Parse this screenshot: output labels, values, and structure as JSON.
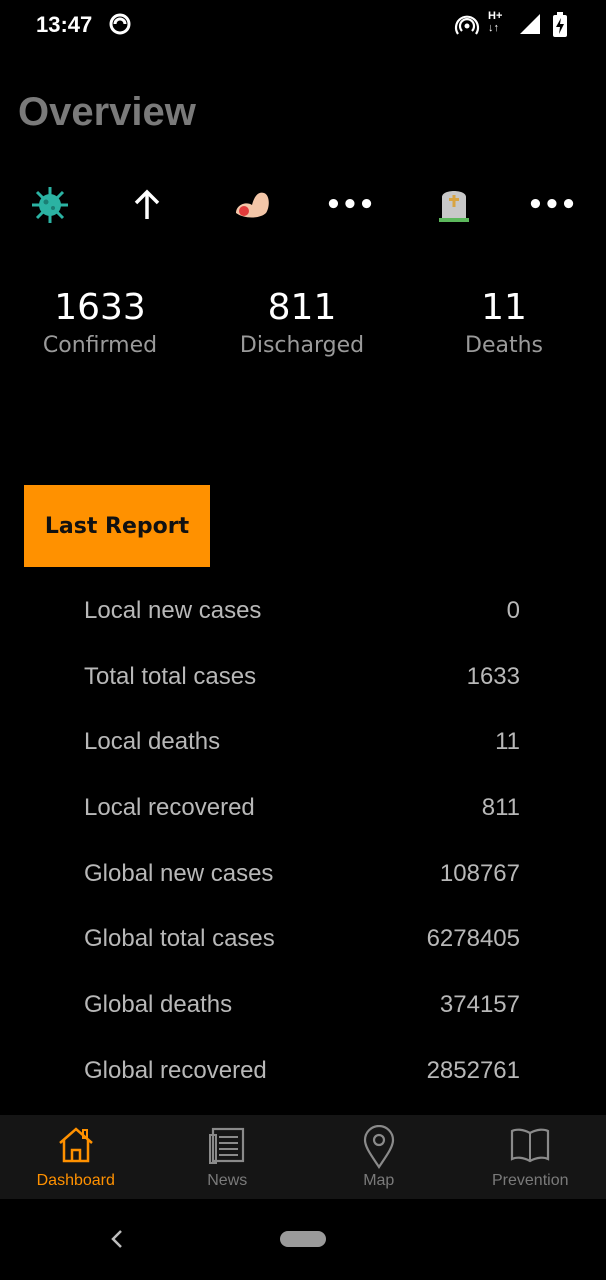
{
  "status_bar": {
    "time": "13:47",
    "network_label": "H+"
  },
  "page": {
    "title": "Overview"
  },
  "icons": [
    "virus-icon",
    "arrow-up-icon",
    "flexed-biceps-icon",
    "more-icon",
    "headstone-icon",
    "more-icon"
  ],
  "stats": {
    "confirmed": {
      "value": "1633",
      "label": "Confirmed"
    },
    "discharged": {
      "value": "811",
      "label": "Discharged"
    },
    "deaths": {
      "value": "11",
      "label": "Deaths"
    }
  },
  "last_report": {
    "button_label": "Last Report",
    "rows": [
      {
        "label": "Local new cases",
        "value": "0"
      },
      {
        "label": "Total total cases",
        "value": "1633"
      },
      {
        "label": "Local deaths",
        "value": "11"
      },
      {
        "label": "Local recovered",
        "value": "811"
      },
      {
        "label": "Global new cases",
        "value": "108767"
      },
      {
        "label": "Global total cases",
        "value": "6278405"
      },
      {
        "label": "Global deaths",
        "value": "374157"
      },
      {
        "label": "Global recovered",
        "value": "2852761"
      }
    ]
  },
  "bottom_nav": {
    "dashboard": "Dashboard",
    "news": "News",
    "map": "Map",
    "prevention": "Prevention",
    "active": "dashboard"
  },
  "colors": {
    "accent": "#ff9100",
    "background": "#000000",
    "nav_background": "#151515"
  }
}
